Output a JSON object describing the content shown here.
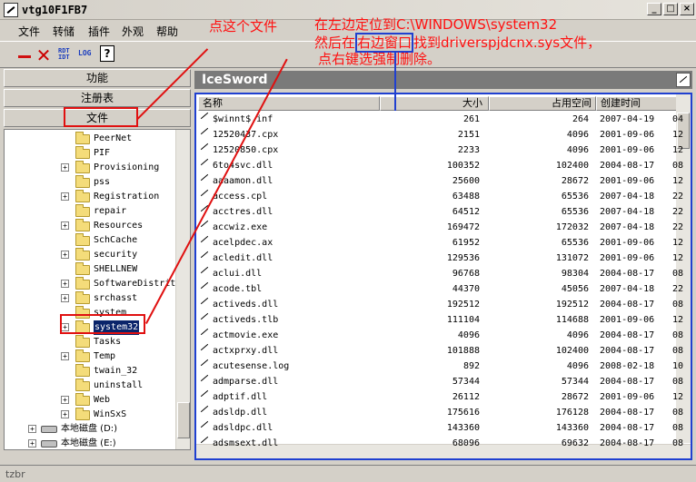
{
  "window": {
    "title": "vtg10F1FB7"
  },
  "menu": [
    "文件",
    "转储",
    "插件",
    "外观",
    "帮助"
  ],
  "toolbar": {
    "icon1_top": "RDT",
    "icon1_bot": "IDT",
    "log": "LOG",
    "help": "?"
  },
  "left": {
    "btn_func": "功能",
    "btn_reg": "注册表",
    "btn_file": "文件",
    "tree": [
      {
        "label": "PeerNet",
        "expand": false
      },
      {
        "label": "PIF",
        "expand": false
      },
      {
        "label": "Provisioning",
        "expand": true
      },
      {
        "label": "pss",
        "expand": false
      },
      {
        "label": "Registration",
        "expand": true
      },
      {
        "label": "repair",
        "expand": false
      },
      {
        "label": "Resources",
        "expand": true
      },
      {
        "label": "SchCache",
        "expand": false
      },
      {
        "label": "security",
        "expand": true
      },
      {
        "label": "SHELLNEW",
        "expand": false
      },
      {
        "label": "SoftwareDistrit",
        "expand": true
      },
      {
        "label": "srchasst",
        "expand": true
      },
      {
        "label": "system",
        "expand": false
      },
      {
        "label": "system32",
        "expand": true,
        "selected": true
      },
      {
        "label": "Tasks",
        "expand": false
      },
      {
        "label": "Temp",
        "expand": true
      },
      {
        "label": "twain_32",
        "expand": false
      },
      {
        "label": "uninstall",
        "expand": false
      },
      {
        "label": "Web",
        "expand": true
      },
      {
        "label": "WinSxS",
        "expand": true
      }
    ],
    "drives": [
      "本地磁盘 (D:)",
      "本地磁盘 (E:)"
    ]
  },
  "right": {
    "header": "IceSword",
    "columns": [
      "名称",
      "大小",
      "占用空间",
      "创建时间"
    ],
    "rows": [
      [
        "$winnt$.inf",
        "261",
        "264",
        "2007-04-19",
        "04"
      ],
      [
        "12520437.cpx",
        "2151",
        "4096",
        "2001-09-06",
        "12"
      ],
      [
        "12520850.cpx",
        "2233",
        "4096",
        "2001-09-06",
        "12"
      ],
      [
        "6to4svc.dll",
        "100352",
        "102400",
        "2004-08-17",
        "08"
      ],
      [
        "aaaamon.dll",
        "25600",
        "28672",
        "2001-09-06",
        "12"
      ],
      [
        "access.cpl",
        "63488",
        "65536",
        "2007-04-18",
        "22"
      ],
      [
        "acctres.dll",
        "64512",
        "65536",
        "2007-04-18",
        "22"
      ],
      [
        "accwiz.exe",
        "169472",
        "172032",
        "2007-04-18",
        "22"
      ],
      [
        "acelpdec.ax",
        "61952",
        "65536",
        "2001-09-06",
        "12"
      ],
      [
        "acledit.dll",
        "129536",
        "131072",
        "2001-09-06",
        "12"
      ],
      [
        "aclui.dll",
        "96768",
        "98304",
        "2004-08-17",
        "08"
      ],
      [
        "acode.tbl",
        "44370",
        "45056",
        "2007-04-18",
        "22"
      ],
      [
        "activeds.dll",
        "192512",
        "192512",
        "2004-08-17",
        "08"
      ],
      [
        "activeds.tlb",
        "111104",
        "114688",
        "2001-09-06",
        "12"
      ],
      [
        "actmovie.exe",
        "4096",
        "4096",
        "2004-08-17",
        "08"
      ],
      [
        "actxprxy.dll",
        "101888",
        "102400",
        "2004-08-17",
        "08"
      ],
      [
        "acutesense.log",
        "892",
        "4096",
        "2008-02-18",
        "10"
      ],
      [
        "admparse.dll",
        "57344",
        "57344",
        "2004-08-17",
        "08"
      ],
      [
        "adptif.dll",
        "26112",
        "28672",
        "2001-09-06",
        "12"
      ],
      [
        "adsldp.dll",
        "175616",
        "176128",
        "2004-08-17",
        "08"
      ],
      [
        "adsldpc.dll",
        "143360",
        "143360",
        "2004-08-17",
        "08"
      ],
      [
        "adsmsext.dll",
        "68096",
        "69632",
        "2004-08-17",
        "08"
      ]
    ]
  },
  "status": "tzbr",
  "annotations": {
    "note1": "点这个文件",
    "note2_a": "在左边定位到C:\\WINDOWS\\system32",
    "note2_b_pre": "然后在",
    "note2_b_box": "右边窗口",
    "note2_b_post": "找到driverspjdcnx.sys文件，",
    "note3": "点右键选强制删除。"
  }
}
